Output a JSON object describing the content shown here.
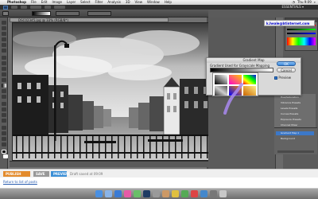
{
  "menubar": {
    "app": "Photoshop",
    "items": [
      "File",
      "Edit",
      "Image",
      "Layer",
      "Select",
      "Filter",
      "Analysis",
      "3D",
      "View",
      "Window",
      "Help"
    ],
    "clock": "Thu 9:09"
  },
  "appbar": {
    "workspace": "ESSENTIALS ▾"
  },
  "document": {
    "tab_title": "DSC02345.jpg @ 33% (RGB/8*)"
  },
  "right_panel": {
    "email": "k.heale@btinternet.com",
    "layers": [
      {
        "label": "Hue/Saturation"
      },
      {
        "label": "Vibrance Presets"
      },
      {
        "label": "Levels Presets"
      },
      {
        "label": "Curves Presets"
      },
      {
        "label": "Exposure Presets"
      },
      {
        "label": "Channel Mixer"
      }
    ],
    "layer_stack": [
      {
        "label": "Gradient Map 1"
      },
      {
        "label": "Background"
      }
    ]
  },
  "dialog": {
    "window_title": "Gradient Map",
    "section_title": "Gradient Used for Grayscale Mapping",
    "ok_label": "OK",
    "cancel_label": "Cancel",
    "preview_label": "Preview",
    "preview_checked": true
  },
  "blogger": {
    "publish_label": "PUBLISH POST",
    "save_label": "SAVE NOW",
    "preview_label": "PREVIEW",
    "draft_status": "Draft saved at 09:09",
    "return_link": "Return to list of posts"
  },
  "colors": {
    "accent": "#3c78c8",
    "ok_button": "#3a86d8",
    "publish_orange": "#e38b2c",
    "annotation_stroke": "#a98af0"
  },
  "dock_icons": [
    "finder-icon",
    "mail-icon",
    "browser-icon",
    "itunes-icon",
    "iphoto-icon",
    "photoshop-icon",
    "preferences-icon",
    "trash-icon"
  ]
}
